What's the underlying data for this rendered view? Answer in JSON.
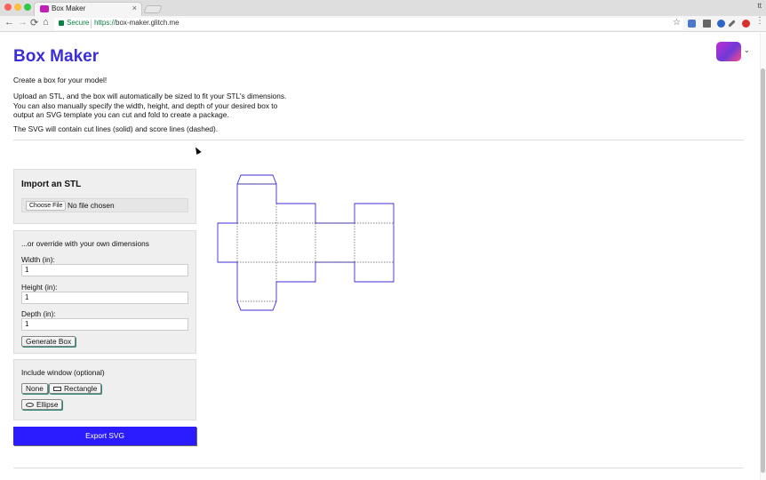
{
  "browser": {
    "tab_title": "Box Maker",
    "tab_close": "×",
    "profile_initial": "tt",
    "secure_label": "Secure",
    "url_scheme": "https://",
    "url_host": "box-maker.glitch.me",
    "back": "←",
    "forward": "→",
    "reload": "⟳",
    "home": "⌂",
    "star": "☆"
  },
  "page": {
    "title": "Box Maker",
    "intro": "Create a box for your model!",
    "description": "Upload an STL, and the box will automatically be sized to fit your STL's dimensions. You can also manually specify the width, height, and depth of your desired box to output an SVG template you can cut and fold to create a package.",
    "svg_note": "The SVG will contain cut lines (solid) and score lines (dashed).",
    "avatar_caret": "⌄"
  },
  "import_panel": {
    "title": "Import an STL",
    "choose_file_label": "Choose File",
    "file_status": "No file chosen"
  },
  "dimensions_panel": {
    "subtitle": "...or override with your own dimensions",
    "width_label": "Width (in):",
    "width_value": "1",
    "height_label": "Height (in):",
    "height_value": "1",
    "depth_label": "Depth (in):",
    "depth_value": "1",
    "generate_label": "Generate Box"
  },
  "window_panel": {
    "title": "Include window (optional)",
    "none_label": "None",
    "rectangle_label": "Rectangle",
    "ellipse_label": "Ellipse"
  },
  "export": {
    "label": "Export SVG"
  },
  "colors": {
    "accent": "#2b1bff",
    "title": "#3b2ed9",
    "template_stroke": "#3b2ed9"
  }
}
